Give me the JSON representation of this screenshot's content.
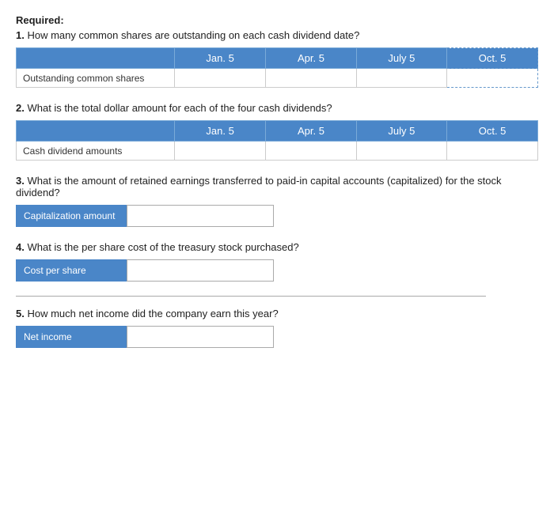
{
  "required_label": "Required:",
  "questions": [
    {
      "id": "q1",
      "number": "1.",
      "text": "How many common shares are outstanding on each cash dividend date?",
      "table": {
        "headers": [
          "",
          "Jan. 5",
          "Apr. 5",
          "July 5",
          "Oct. 5"
        ],
        "rows": [
          {
            "label": "Outstanding common shares",
            "cells": [
              "",
              "",
              "",
              ""
            ]
          }
        ]
      }
    },
    {
      "id": "q2",
      "number": "2.",
      "text": "What is the total dollar amount for each of the four cash dividends?",
      "table": {
        "headers": [
          "",
          "Jan. 5",
          "Apr. 5",
          "July 5",
          "Oct. 5"
        ],
        "rows": [
          {
            "label": "Cash dividend amounts",
            "cells": [
              "",
              "",
              "",
              ""
            ]
          }
        ]
      }
    },
    {
      "id": "q3",
      "number": "3.",
      "text": "What is the amount of retained earnings transferred to paid-in capital accounts (capitalized) for the stock dividend?",
      "inline_label": "Capitalization amount"
    },
    {
      "id": "q4",
      "number": "4.",
      "text": "What is the per share cost of the treasury stock purchased?",
      "inline_label": "Cost per share"
    },
    {
      "id": "q5",
      "number": "5.",
      "text": "How much net income did the company earn this year?",
      "inline_label": "Net income"
    }
  ]
}
